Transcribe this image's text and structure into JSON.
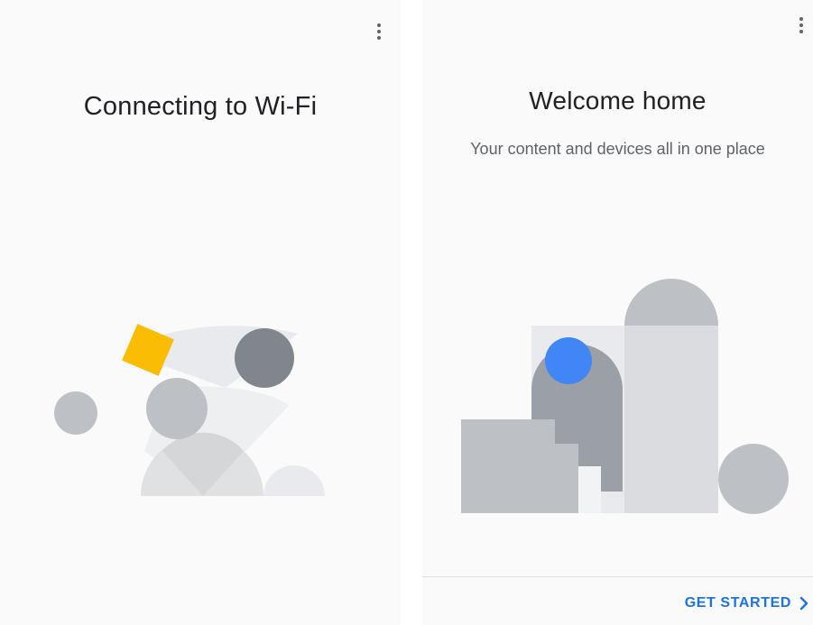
{
  "left_screen": {
    "title": "Connecting to Wi-Fi",
    "menu_icon": "more-vert-icon"
  },
  "right_screen": {
    "title": "Welcome home",
    "subtitle": "Your content and devices all in one place",
    "menu_icon": "more-vert-icon",
    "get_started_label": "GET STARTED",
    "get_started_icon": "chevron-right-icon"
  },
  "colors": {
    "background": "#fafafa",
    "accent_blue": "#4285f4",
    "accent_yellow": "#fbbc04",
    "button_text": "#1a73e8",
    "shape_light": "#e0e0e0",
    "shape_medium": "#bdc1c6",
    "shape_dark": "#80868b"
  }
}
